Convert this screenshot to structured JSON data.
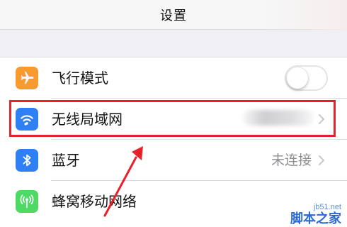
{
  "nav": {
    "title": "设置"
  },
  "settings": {
    "airplane": {
      "label": "飞行模式",
      "toggle_on": false,
      "icon": "airplane-icon",
      "color": "#f89a2e"
    },
    "wlan": {
      "label": "无线局域网",
      "icon": "wifi-icon",
      "color": "#2f7ff5"
    },
    "bluetooth": {
      "label": "蓝牙",
      "value": "未连接",
      "icon": "bluetooth-icon",
      "color": "#2f7ff5"
    },
    "cellular": {
      "label": "蜂窝移动网络",
      "icon": "cellular-icon",
      "color": "#4cd964"
    }
  },
  "annotation": {
    "highlight_color": "#e8202a"
  },
  "watermark": {
    "url": "jb51.net",
    "name": "脚本之家"
  }
}
